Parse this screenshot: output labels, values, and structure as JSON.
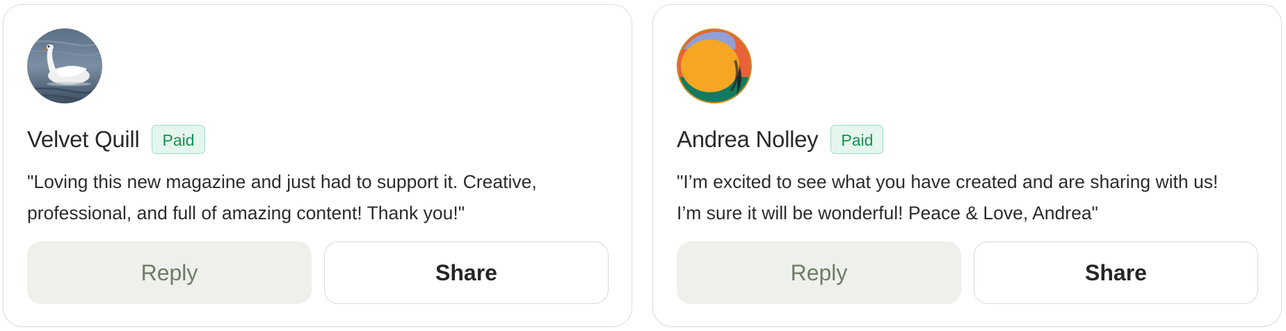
{
  "comments": [
    {
      "avatar_icon": "swan-photo-avatar",
      "name": "Velvet Quill",
      "badge": "Paid",
      "message": "\"Loving this new magazine and just had to support it. Creative,\nprofessional, and full of amazing content! Thank you!\"",
      "reply_label": "Reply",
      "share_label": "Share"
    },
    {
      "avatar_icon": "abstract-circle-avatar",
      "name": "Andrea Nolley",
      "badge": "Paid",
      "message": "\"I’m excited to see what you have created and are sharing with us!\nI’m sure it will be wonderful! Peace & Love, Andrea\"",
      "reply_label": "Reply",
      "share_label": "Share"
    }
  ],
  "colors": {
    "badge_text": "#16924f",
    "badge_bg": "#e4f6ee",
    "reply_bg": "#eef0eb",
    "reply_text": "#6e7b68"
  }
}
